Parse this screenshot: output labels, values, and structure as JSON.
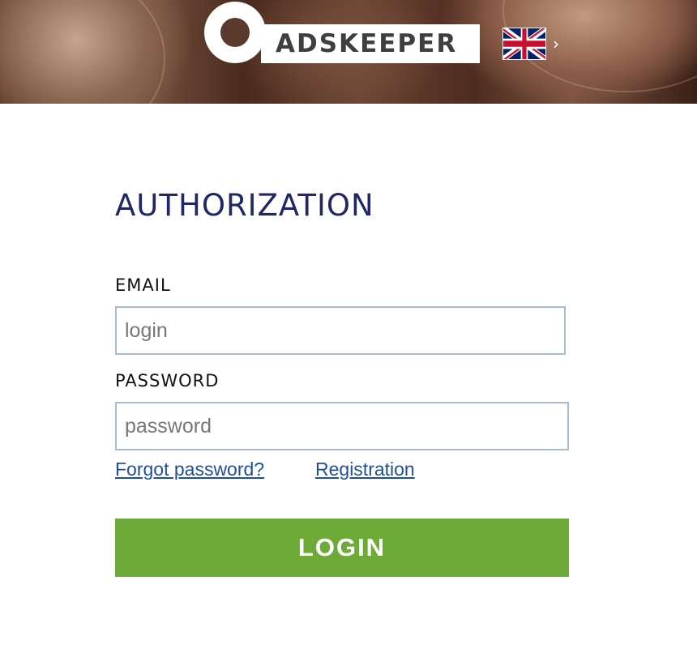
{
  "header": {
    "logo_text": "ADSKEEPER",
    "language": {
      "flag_icon": "uk-flag-icon",
      "chevron_icon": "chevron-right-icon",
      "chevron_glyph": "›"
    }
  },
  "form": {
    "title": "AUTHORIZATION",
    "email": {
      "label": "EMAIL",
      "placeholder": "login",
      "value": ""
    },
    "password": {
      "label": "PASSWORD",
      "placeholder": "password",
      "value": ""
    },
    "links": {
      "forgot": "Forgot password?",
      "register": "Registration"
    },
    "submit_label": "LOGIN"
  },
  "colors": {
    "title": "#1f2766",
    "link": "#1f4f9c",
    "button": "#6eaa37",
    "input_border": "#aabccb"
  }
}
